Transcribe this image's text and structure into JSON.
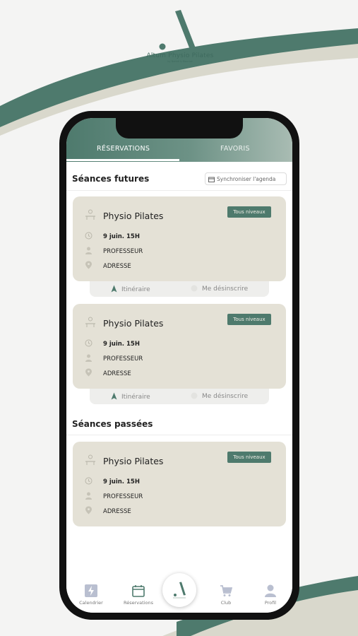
{
  "brand": {
    "title": "Altum Physio Pilates",
    "subtitle": "by Nahidi & Maurice"
  },
  "tabs": [
    {
      "label": "RÉSERVATIONS",
      "active": true
    },
    {
      "label": "FAVORIS",
      "active": false
    }
  ],
  "future": {
    "title": "Séances futures",
    "sync_label": "Synchroniser l'agenda"
  },
  "past": {
    "title": "Séances passées"
  },
  "cards": [
    {
      "title": "Physio Pilates",
      "badge": "Tous niveaux",
      "datetime": "9 juin. 15H",
      "teacher": "PROFESSEUR",
      "address": "ADRESSE",
      "itinerary": "Itinéraire",
      "unsubscribe": "Me désinscrire"
    },
    {
      "title": "Physio Pilates",
      "badge": "Tous niveaux",
      "datetime": "9 juin. 15H",
      "teacher": "PROFESSEUR",
      "address": "ADRESSE",
      "itinerary": "Itinéraire",
      "unsubscribe": "Me désinscrire"
    },
    {
      "title": "Physio Pilates",
      "badge": "Tous niveaux",
      "datetime": "9 juin. 15H",
      "teacher": "PROFESSEUR",
      "address": "ADRESSE"
    }
  ],
  "nav": [
    {
      "label": "Calendrier",
      "icon": "lightning-icon"
    },
    {
      "label": "Réservations",
      "icon": "calendar-icon"
    },
    {
      "label": "",
      "icon": "altum-logo-icon"
    },
    {
      "label": "Club",
      "icon": "cart-icon"
    },
    {
      "label": "Profil",
      "icon": "user-icon"
    }
  ],
  "colors": {
    "accent": "#4e7a6d",
    "card": "#e4e1d6",
    "actions": "#eeeeec",
    "badge_text": "#f1efe7"
  }
}
